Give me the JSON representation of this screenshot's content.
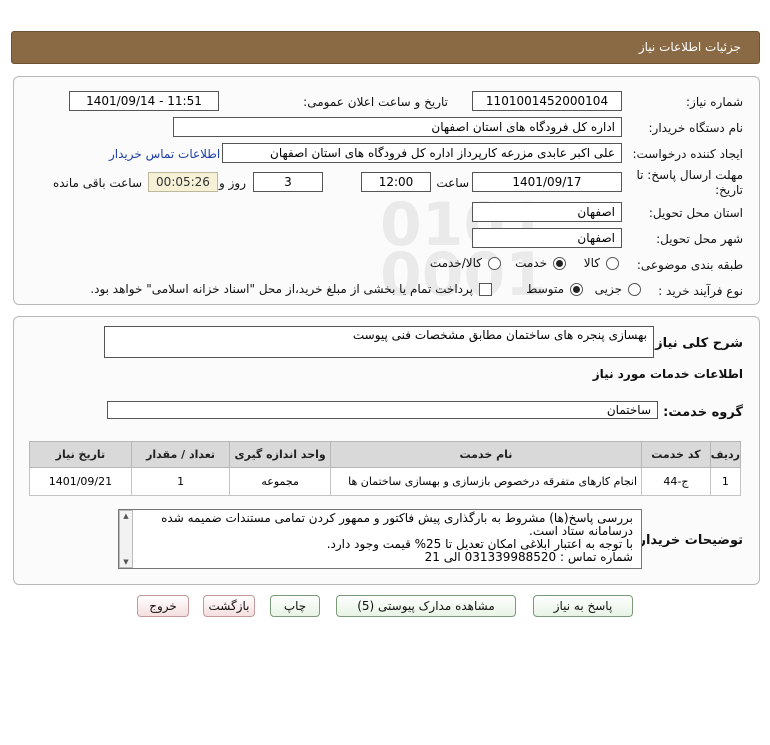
{
  "header": {
    "title": "جزئیات اطلاعات نیاز"
  },
  "form": {
    "need_number_label": "شماره نیاز:",
    "need_number": "1101001452000104",
    "announce_label": "تاریخ و ساعت اعلان عمومی:",
    "announce_value": "1401/09/14 - 11:51",
    "buyer_org_label": "نام دستگاه خریدار:",
    "buyer_org": "اداره کل فرودگاه های استان اصفهان",
    "requester_label": "ایجاد کننده درخواست:",
    "requester": "علی اکبر عابدی مزرعه کارپرداز اداره کل فرودگاه های استان اصفهان",
    "contact_link": "اطلاعات تماس خریدار",
    "deadline_label_1": "مهلت ارسال پاسخ: تا",
    "deadline_label_2": "تاریخ:",
    "deadline_date": "1401/09/17",
    "time_label": "ساعت",
    "deadline_time": "12:00",
    "days_value": "3",
    "days_label": "روز و",
    "remaining_time": "00:05:26",
    "remaining_label": "ساعت باقی مانده",
    "province_label": "استان محل تحویل:",
    "province": "اصفهان",
    "city_label": "شهر محل تحویل:",
    "city": "اصفهان",
    "category_label": "طبقه بندی موضوعی:",
    "category_options": [
      "کالا",
      "خدمت",
      "کالا/خدمت"
    ],
    "category_selected": "خدمت",
    "process_label": "نوع فرآیند خرید :",
    "process_options": [
      "جزیی",
      "متوسط"
    ],
    "process_selected": "متوسط",
    "payment_note": "پرداخت تمام یا بخشی از مبلغ خرید،از محل \"اسناد خزانه اسلامی\" خواهد بود."
  },
  "summary": {
    "label": "شرح کلی نیاز:",
    "text": "بهسازی پنجره های ساختمان مطابق مشخصات فنی پیوست"
  },
  "services": {
    "heading": "اطلاعات خدمات مورد نیاز",
    "group_label": "گروه خدمت:",
    "group_value": "ساختمان",
    "columns": [
      "ردیف",
      "کد خدمت",
      "نام خدمت",
      "واحد اندازه گیری",
      "تعداد / مقدار",
      "تاریخ نیاز"
    ],
    "rows": [
      [
        "1",
        "ج-44",
        "انجام کارهای متفرقه درخصوص بازسازی و بهسازی ساختمان ها",
        "مجموعه",
        "1",
        "1401/09/21"
      ]
    ]
  },
  "buyer_notes": {
    "label": "توضیحات خریدار:",
    "lines": [
      "بررسی پاسخ(ها) مشروط  به بارگذاری پیش فاکتور و ممهور کردن تمامی مستندات ضمیمه شده درسامانه  ستاد است.",
      "با توجه به اعتبار ابلاغی امکان تعدیل تا 25% قیمت وجود دارد.",
      "شماره تماس : 031339988520 الی 21"
    ]
  },
  "buttons": {
    "reply": "پاسخ به نیاز",
    "attachments": "مشاهده مدارک پیوستی (5)",
    "print": "چاپ",
    "back": "بازگشت",
    "exit": "خروج"
  },
  "colors": {
    "header_bg": "#8a6a44",
    "link": "#1f3fa8",
    "timer_bg": "#f5f0d6"
  }
}
